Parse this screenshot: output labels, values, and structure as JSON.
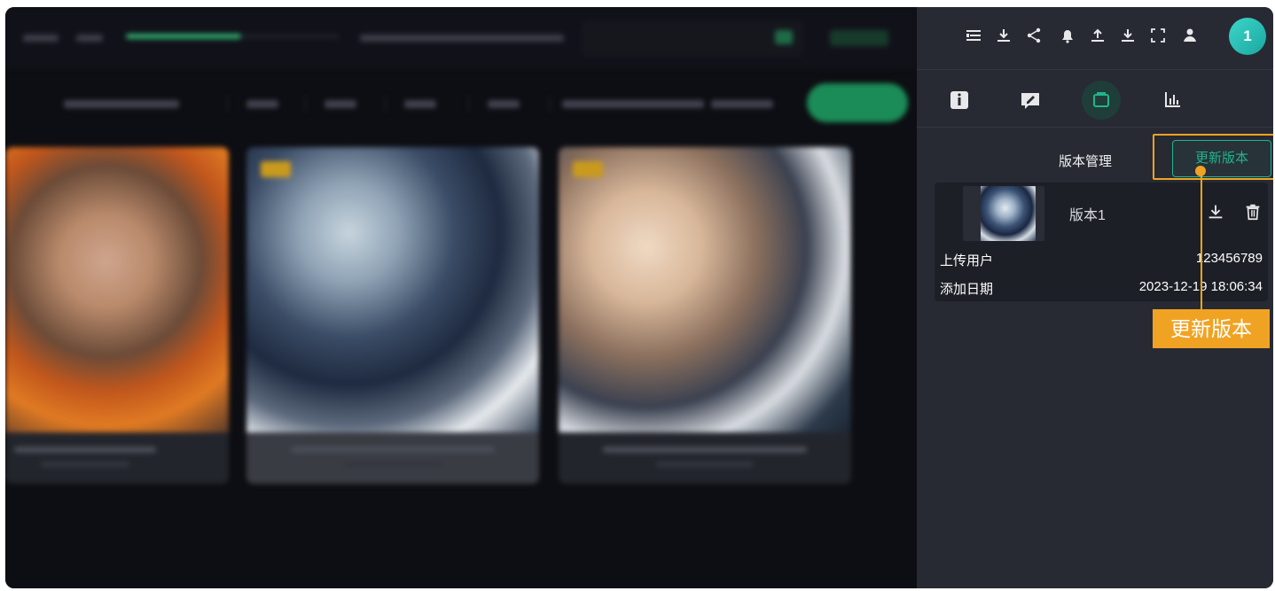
{
  "header": {
    "avatar_badge": "1",
    "toolbar_icons": [
      "list-icon",
      "download-icon",
      "share-icon",
      "bell-icon",
      "upload-icon",
      "download-alt-icon",
      "fullscreen-icon",
      "user-icon"
    ]
  },
  "panel_tabs": [
    "info-icon",
    "edit-icon",
    "version-icon",
    "chart-icon"
  ],
  "version_manager": {
    "title": "版本管理",
    "update_button": "更新版本",
    "versions": [
      {
        "name": "版本1",
        "uploader_label": "上传用户",
        "uploader_value": "123456789",
        "date_label": "添加日期",
        "date_value": "2023-12-19 18:06:34"
      }
    ]
  },
  "annotation": {
    "callout_text": "更新版本",
    "color": "#f0a323"
  },
  "colors": {
    "accent": "#22b48c",
    "panel_bg": "#272a33",
    "highlight": "#f0a323"
  }
}
